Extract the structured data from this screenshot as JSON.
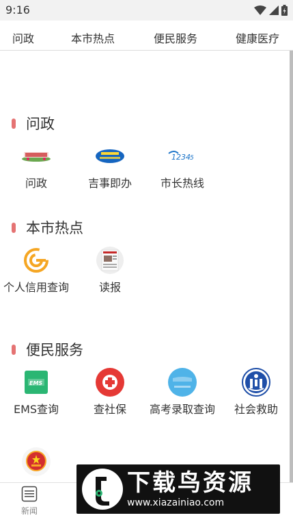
{
  "status_bar": {
    "time": "9:16",
    "icons": [
      "wifi-icon",
      "signal-icon",
      "battery-icon"
    ]
  },
  "tabs": [
    {
      "label": "问政"
    },
    {
      "label": "本市热点"
    },
    {
      "label": "便民服务"
    },
    {
      "label": "健康医疗"
    }
  ],
  "sections": [
    {
      "title": "问政",
      "items": [
        {
          "label": "问政",
          "icon": "wenzheng-logo-icon"
        },
        {
          "label": "吉事即办",
          "icon": "jishijiban-logo-icon"
        },
        {
          "label": "市长热线",
          "icon": "hotline-12345-icon"
        }
      ]
    },
    {
      "title": "本市热点",
      "items": [
        {
          "label": "个人信用查询",
          "icon": "credit-query-icon"
        },
        {
          "label": "读报",
          "icon": "newspaper-icon"
        }
      ]
    },
    {
      "title": "便民服务",
      "items": [
        {
          "label": "EMS查询",
          "icon": "ems-icon"
        },
        {
          "label": "查社保",
          "icon": "social-security-icon"
        },
        {
          "label": "高考录取查询",
          "icon": "gaokao-icon"
        },
        {
          "label": "社会救助",
          "icon": "social-aid-icon"
        },
        {
          "label": "",
          "icon": "national-emblem-icon"
        }
      ]
    }
  ],
  "bottom_nav": [
    {
      "label": "新闻",
      "icon": "news-icon"
    },
    {
      "label": "",
      "icon": "nav-2-icon"
    },
    {
      "label": "",
      "icon": "nav-3-icon"
    },
    {
      "label": "",
      "icon": "nav-4-icon"
    },
    {
      "label": "",
      "icon": "nav-5-icon"
    }
  ],
  "watermark": {
    "title": "下载鸟资源",
    "url": "www.xiazainiao.com"
  },
  "colors": {
    "section_marker": "#e57373",
    "ems_green": "#2bb673",
    "shebao_red": "#e53935",
    "gaokao_blue": "#4fb3e8",
    "aid_blue": "#1f4fa8",
    "credit_orange": "#f5a623"
  }
}
